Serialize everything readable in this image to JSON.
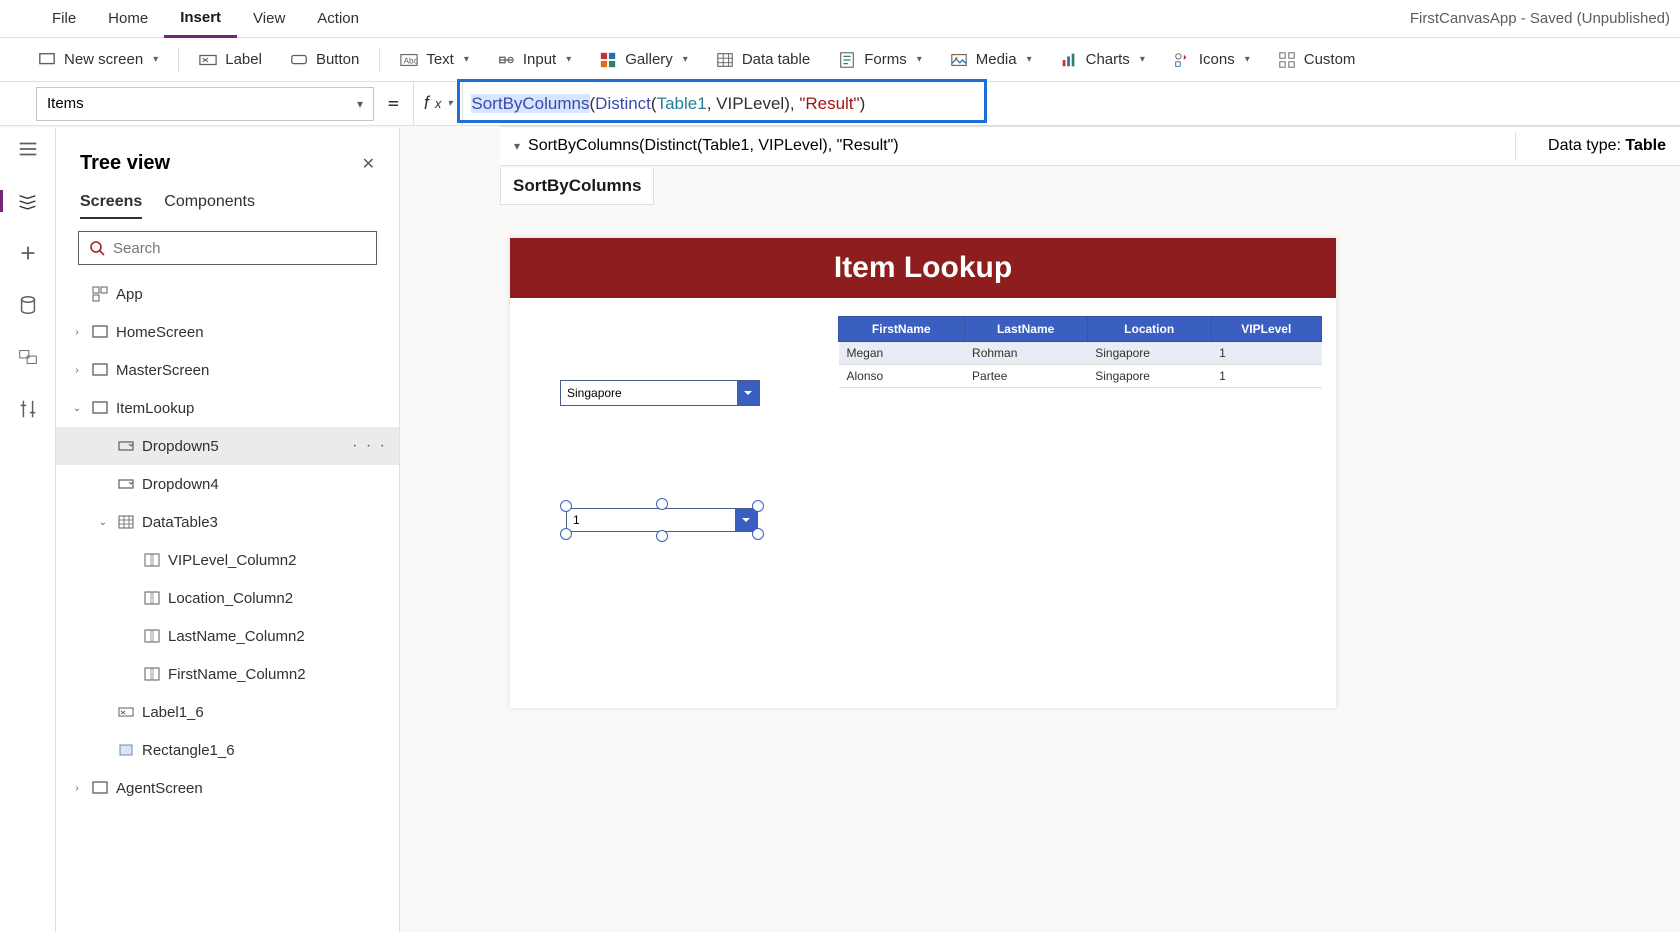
{
  "app_title": "FirstCanvasApp - Saved (Unpublished)",
  "menubar": {
    "items": [
      "File",
      "Home",
      "Insert",
      "View",
      "Action"
    ],
    "active_index": 2
  },
  "ribbon": {
    "newscreen": "New screen",
    "label": "Label",
    "button": "Button",
    "text": "Text",
    "input": "Input",
    "gallery": "Gallery",
    "datatable": "Data table",
    "forms": "Forms",
    "media": "Media",
    "charts": "Charts",
    "icons": "Icons",
    "custom": "Custom"
  },
  "prop": {
    "selected": "Items",
    "formula_tokens": [
      {
        "t": "SortByColumns",
        "c": "fn"
      },
      {
        "t": "(",
        "c": "p"
      },
      {
        "t": "Distinct",
        "c": "fn2"
      },
      {
        "t": "(",
        "c": "p"
      },
      {
        "t": "Table1",
        "c": "tbl"
      },
      {
        "t": ", ",
        "c": "p"
      },
      {
        "t": "VIPLevel",
        "c": "p"
      },
      {
        "t": ")",
        "c": "p"
      },
      {
        "t": ", ",
        "c": "p"
      },
      {
        "t": "\"Result\"",
        "c": "str"
      },
      {
        "t": ")",
        "c": "p"
      }
    ]
  },
  "infobar": {
    "formula_echo": "SortByColumns(Distinct(Table1, VIPLevel), \"Result\")",
    "datatype_label": "Data type: ",
    "datatype_value": "Table"
  },
  "fnhint": "SortByColumns",
  "tree": {
    "title": "Tree view",
    "tabs": {
      "screens": "Screens",
      "components": "Components"
    },
    "search_placeholder": "Search",
    "nodes": [
      {
        "depth": 0,
        "icon": "app",
        "label": "App"
      },
      {
        "depth": 0,
        "icon": "screen",
        "label": "HomeScreen",
        "exp": ">"
      },
      {
        "depth": 0,
        "icon": "screen",
        "label": "MasterScreen",
        "exp": ">"
      },
      {
        "depth": 0,
        "icon": "screen",
        "label": "ItemLookup",
        "exp": "v"
      },
      {
        "depth": 1,
        "icon": "ddl",
        "label": "Dropdown5",
        "selected": true,
        "more": true
      },
      {
        "depth": 1,
        "icon": "ddl",
        "label": "Dropdown4"
      },
      {
        "depth": 1,
        "icon": "tbl",
        "label": "DataTable3",
        "exp": "v"
      },
      {
        "depth": 2,
        "icon": "col",
        "label": "VIPLevel_Column2"
      },
      {
        "depth": 2,
        "icon": "col",
        "label": "Location_Column2"
      },
      {
        "depth": 2,
        "icon": "col",
        "label": "LastName_Column2"
      },
      {
        "depth": 2,
        "icon": "col",
        "label": "FirstName_Column2"
      },
      {
        "depth": 1,
        "icon": "lbl",
        "label": "Label1_6"
      },
      {
        "depth": 1,
        "icon": "rect",
        "label": "Rectangle1_6"
      },
      {
        "depth": 0,
        "icon": "screen",
        "label": "AgentScreen",
        "exp": ">"
      }
    ]
  },
  "canvas": {
    "header": "Item Lookup",
    "dd1_value": "Singapore",
    "dd2_value": "1",
    "dt_headers": [
      "FirstName",
      "LastName",
      "Location",
      "VIPLevel"
    ],
    "dt_rows": [
      [
        "Megan",
        "Rohman",
        "Singapore",
        "1"
      ],
      [
        "Alonso",
        "Partee",
        "Singapore",
        "1"
      ]
    ]
  }
}
